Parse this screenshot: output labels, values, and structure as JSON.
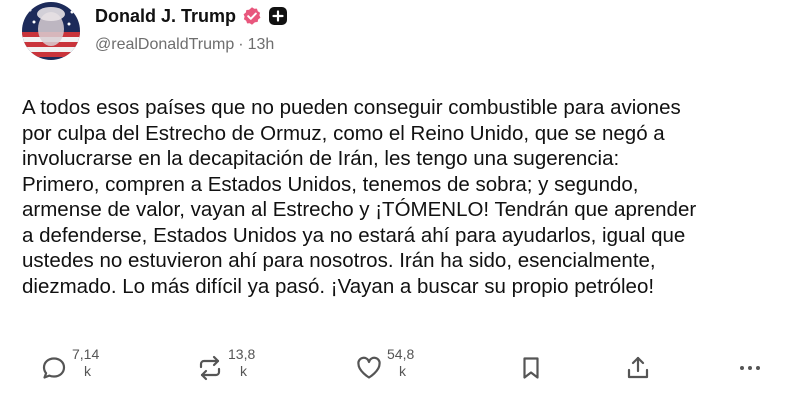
{
  "post": {
    "author": {
      "display_name": "Donald J. Trump",
      "handle": "@realDonaldTrump",
      "separator": "·",
      "time_ago": "13h"
    },
    "text_lines": [
      "A todos esos países que no pueden conseguir combustible para aviones",
      "por culpa del Estrecho de Ormuz, como el Reino Unido, que se negó a",
      "involucrarse en la decapitación de Irán, les tengo una sugerencia:",
      "Primero, compren a Estados Unidos, tenemos de sobra; y segundo,",
      "armense de valor, vayan al Estrecho y ¡TÓMENLO! Tendrán que aprender",
      "a defenderse, Estados Unidos ya no estará ahí para ayudarlos, igual que",
      "ustedes no estuvieron ahí para nosotros. Irán ha sido, esencialmente,",
      "diezmado. Lo más difícil ya pasó. ¡Vayan a buscar su propio petróleo!"
    ],
    "actions": {
      "replies": {
        "value": "7,14",
        "unit": "k"
      },
      "reposts": {
        "value": "13,8",
        "unit": "k"
      },
      "likes": {
        "value": "54,8",
        "unit": "k"
      }
    },
    "icons": {
      "verified": "verified-badge-icon",
      "follow": "plus-icon",
      "reply": "speech-bubble-icon",
      "repost": "repost-arrows-icon",
      "like": "heart-icon",
      "bookmark": "bookmark-icon",
      "share": "share-icon",
      "more": "more-dots-icon"
    },
    "colors": {
      "verified_badge": "#e8577d",
      "text": "#111111",
      "muted": "#6e6e6e"
    }
  }
}
